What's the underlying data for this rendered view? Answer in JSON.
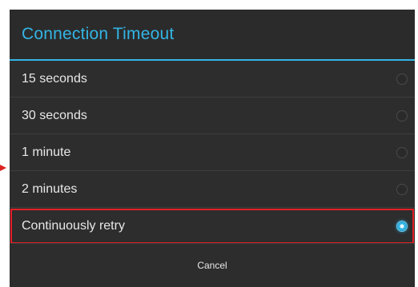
{
  "dialog": {
    "title": "Connection Timeout",
    "options": [
      {
        "label": "15 seconds",
        "selected": false
      },
      {
        "label": "30 seconds",
        "selected": false
      },
      {
        "label": "1 minute",
        "selected": false
      },
      {
        "label": "2 minutes",
        "selected": false
      },
      {
        "label": "Continuously retry",
        "selected": true
      }
    ],
    "cancel_label": "Cancel"
  },
  "colors": {
    "accent": "#33b5e5",
    "background": "#2d2d2d",
    "highlight_outline": "#e21f26"
  }
}
